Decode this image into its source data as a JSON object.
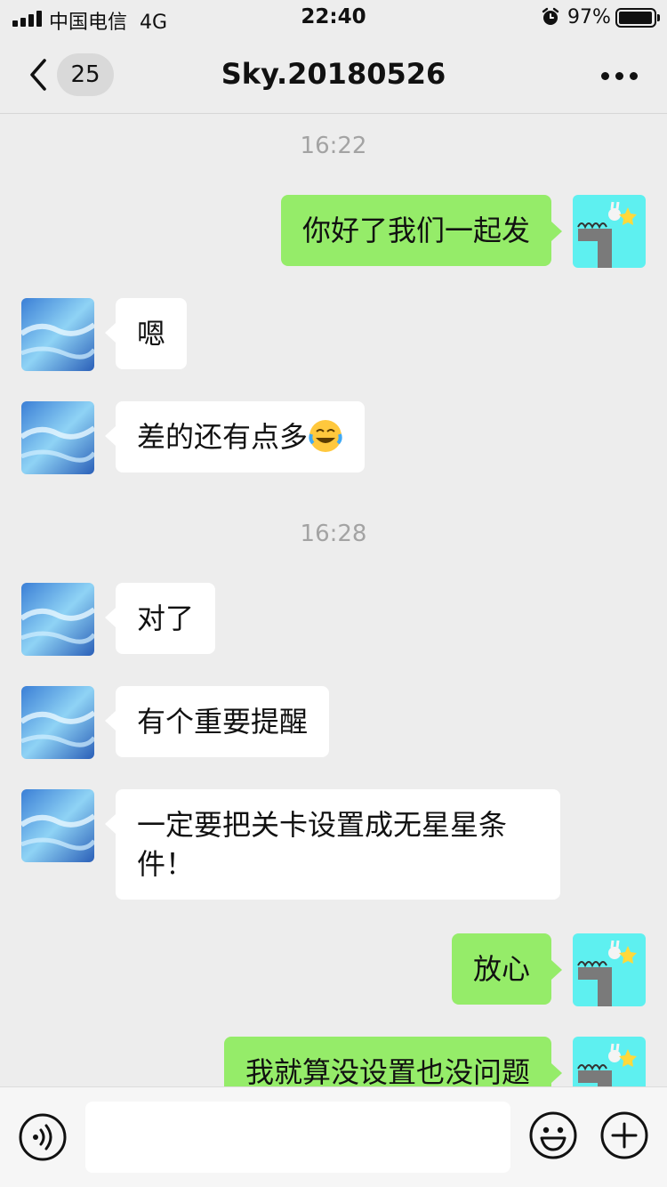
{
  "status_bar": {
    "carrier": "中国电信",
    "network": "4G",
    "time": "22:40",
    "battery": "97%",
    "battery_level": 0.97,
    "icons": [
      "signal-icon",
      "alarm-icon",
      "battery-icon"
    ]
  },
  "nav": {
    "unread_count": "25",
    "title": "Sky.20180526",
    "icons": [
      "back-arrow-icon",
      "more-dots-icon"
    ]
  },
  "colors": {
    "background": "#ededed",
    "outgoing_bubble": "#95ec69",
    "incoming_bubble": "#ffffff",
    "timestamp": "#a3a3a3"
  },
  "messages": [
    {
      "type": "time",
      "text": "16:22"
    },
    {
      "type": "msg",
      "side": "right",
      "text": "你好了我们一起发",
      "avatar": "game-character-avatar"
    },
    {
      "type": "msg",
      "side": "left",
      "text": "嗯",
      "avatar": "sky-clouds-avatar"
    },
    {
      "type": "msg",
      "side": "left",
      "text": "差的还有点多",
      "emoji": "laughing-crying-emoji",
      "avatar": "sky-clouds-avatar"
    },
    {
      "type": "time",
      "text": "16:28"
    },
    {
      "type": "msg",
      "side": "left",
      "text": "对了",
      "avatar": "sky-clouds-avatar"
    },
    {
      "type": "msg",
      "side": "left",
      "text": "有个重要提醒",
      "avatar": "sky-clouds-avatar"
    },
    {
      "type": "msg",
      "side": "left",
      "text": "一定要把关卡设置成无星星条件！",
      "avatar": "sky-clouds-avatar"
    },
    {
      "type": "msg",
      "side": "right",
      "text": "放心",
      "avatar": "game-character-avatar"
    },
    {
      "type": "msg",
      "side": "right",
      "text": "我就算没设置也没问题",
      "avatar": "game-character-avatar"
    }
  ],
  "input_bar": {
    "placeholder": "",
    "icons": [
      "voice-icon",
      "emoji-icon",
      "plus-icon"
    ]
  }
}
